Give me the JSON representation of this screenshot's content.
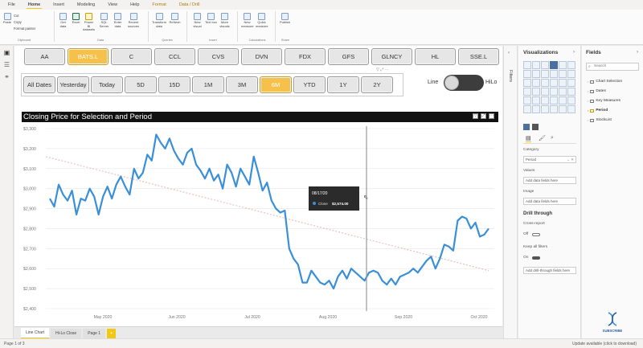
{
  "ribbon": {
    "tabs": [
      "File",
      "Home",
      "Insert",
      "Modeling",
      "View",
      "Help",
      "Format",
      "Data / Drill"
    ],
    "active_tab": "Home",
    "clipboard": {
      "paste": "Paste",
      "cut": "Cut",
      "copy": "Copy",
      "format_painter": "Format painter",
      "group": "Clipboard"
    },
    "data": {
      "get_data": "Get data",
      "excel": "Excel",
      "power_bi_datasets": "Power BI datasets",
      "sql_server": "SQL Server",
      "enter_data": "Enter data",
      "recent_sources": "Recent sources",
      "group": "Data"
    },
    "queries": {
      "transform": "Transform data",
      "refresh": "Refresh",
      "group": "Queries"
    },
    "insert": {
      "new_visual": "New visual",
      "text_box": "Text box",
      "more_visuals": "More visuals",
      "group": "Insert"
    },
    "calculations": {
      "new_measure": "New measure",
      "quick_measure": "Quick measure",
      "group": "Calculations"
    },
    "share": {
      "publish": "Publish",
      "group": "Share"
    }
  },
  "stock_buttons": [
    "AA",
    "BATS.L",
    "C",
    "CCL",
    "CVS",
    "DVN",
    "FDX",
    "GFS",
    "GLNCY",
    "HL",
    "SSE.L"
  ],
  "stock_selected": "BATS.L",
  "period_buttons": [
    "All Dates",
    "Yesterday",
    "Today",
    "5D",
    "15D",
    "1M",
    "3M",
    "6M",
    "YTD",
    "1Y",
    "2Y"
  ],
  "period_selected": "6M",
  "toggle": {
    "left_label": "Line",
    "right_label": "HiLo"
  },
  "chart_title": "Closing Price for Selection and Period",
  "tooltip": {
    "date": "08/17/20",
    "label": "Close",
    "value": "$2,574.00"
  },
  "chart_data": {
    "type": "line",
    "yticks": [
      "$3,300",
      "$3,200",
      "$3,100",
      "$3,000",
      "$2,900",
      "$2,800",
      "$2,700",
      "$2,600",
      "$2,500",
      "$2,400"
    ],
    "xticks": [
      "May 2020",
      "Jun 2020",
      "Jul 2020",
      "Aug 2020",
      "Sep 2020",
      "Oct 2020"
    ],
    "ylim": [
      2400,
      3300
    ],
    "series": [
      {
        "values": [
          2950,
          2910,
          3020,
          2970,
          2940,
          2990,
          2870,
          2950,
          2940,
          3000,
          2960,
          2870,
          2960,
          3010,
          2950,
          3020,
          3060,
          3010,
          2970,
          3100,
          3050,
          3080,
          3170,
          3140,
          3270,
          3230,
          3200,
          3250,
          3190,
          3150,
          3120,
          3180,
          3200,
          3120,
          3090,
          3050,
          3100,
          3040,
          3070,
          3000,
          3120,
          3080,
          3010,
          3100,
          3060,
          3020,
          3160,
          3080,
          2990,
          3030,
          2940,
          2900,
          2880,
          2890,
          2700,
          2650,
          2620,
          2530,
          2530,
          2590,
          2560,
          2530,
          2520,
          2540,
          2500,
          2560,
          2590,
          2550,
          2600,
          2580,
          2560,
          2540,
          2580,
          2590,
          2580,
          2540,
          2520,
          2550,
          2520,
          2560,
          2570,
          2580,
          2600,
          2580,
          2610,
          2640,
          2660,
          2600,
          2650,
          2720,
          2710,
          2690,
          2840,
          2860,
          2850,
          2800,
          2830,
          2760,
          2770,
          2800
        ]
      },
      {
        "values": [
          3160,
          2590
        ]
      }
    ]
  },
  "page_tabs": [
    "Line Chart",
    "Hi-Lo Close",
    "Page 1"
  ],
  "active_page": "Line Chart",
  "status": {
    "left": "Page 1 of 3",
    "right": "Update available (click to download)"
  },
  "filters_label": "Filters",
  "viz_pane": {
    "title": "Visualizations",
    "category_label": "Category",
    "category_value": "Period",
    "values_label": "Values",
    "values_placeholder": "Add data fields here",
    "image_label": "Image",
    "image_placeholder": "Add data fields here",
    "drill_title": "Drill through",
    "cross_report": "Cross-report",
    "cross_state": "Off",
    "keep_filters": "Keep all filters",
    "keep_state": "On",
    "drill_placeholder": "Add drill-through fields here"
  },
  "fields_pane": {
    "title": "Fields",
    "search_placeholder": "Search",
    "items": [
      "Chart Selection",
      "Dates",
      "Key Measures",
      "Period",
      "StockList"
    ]
  },
  "subscribe": "SUBSCRIBE"
}
